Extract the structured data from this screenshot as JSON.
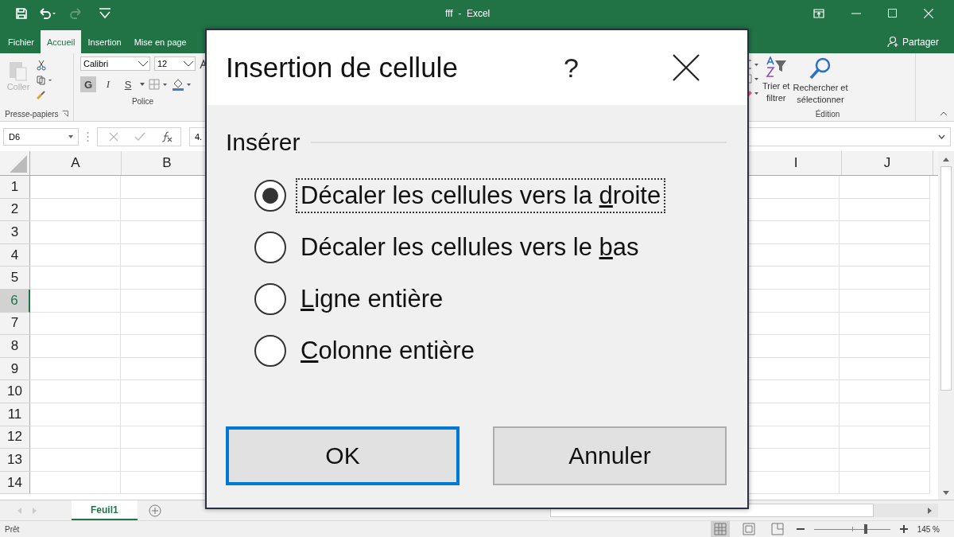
{
  "window": {
    "title": "fff  -  Excel"
  },
  "ribbon_tabs": [
    {
      "label": "Fichier",
      "selected": false
    },
    {
      "label": "Accueil",
      "selected": true
    },
    {
      "label": "Insertion",
      "selected": false
    },
    {
      "label": "Mise en page",
      "selected": false
    }
  ],
  "share": {
    "label": "Partager"
  },
  "clipboard": {
    "paste_label": "Coller",
    "paste_disabled": true,
    "group_label": "Presse-papiers"
  },
  "font_group": {
    "font": "Calibri",
    "size": "12",
    "bold_label": "G",
    "bold_on": true,
    "italic_label": "I",
    "underline_label": "S",
    "group_label": "Police"
  },
  "editing_group": {
    "sort_label": "Trier et\nfiltrer",
    "find_label": "Rechercher et\nsélectionner",
    "group_label": "Édition"
  },
  "formula_bar": {
    "name_box": "D6",
    "value": "4."
  },
  "columns": [
    {
      "label": "A",
      "selected": false
    },
    {
      "label": "B",
      "selected": false
    },
    {
      "label": "I",
      "selected": false
    },
    {
      "label": "J",
      "selected": false
    }
  ],
  "rows": [
    {
      "label": "1",
      "selected": false
    },
    {
      "label": "2",
      "selected": false
    },
    {
      "label": "3",
      "selected": false
    },
    {
      "label": "4",
      "selected": false
    },
    {
      "label": "5",
      "selected": false
    },
    {
      "label": "6",
      "selected": true
    },
    {
      "label": "7",
      "selected": false
    },
    {
      "label": "8",
      "selected": false
    },
    {
      "label": "9",
      "selected": false
    },
    {
      "label": "10",
      "selected": false
    },
    {
      "label": "11",
      "selected": false
    },
    {
      "label": "12",
      "selected": false
    },
    {
      "label": "13",
      "selected": false
    },
    {
      "label": "14",
      "selected": false
    }
  ],
  "sheets": [
    {
      "label": "Feuil1",
      "selected": true
    }
  ],
  "status_bar": {
    "status": "Prêt",
    "views": [
      {
        "kind": "normal",
        "selected": true
      },
      {
        "kind": "layout",
        "selected": false
      },
      {
        "kind": "pagebreak",
        "selected": false
      }
    ],
    "zoom": {
      "level": 0.68,
      "reading": "145 %"
    }
  },
  "dialog": {
    "title": "Insertion de cellule",
    "help": "?",
    "group_label": "Insérer",
    "options": [
      {
        "before": "Décaler les cellules vers la ",
        "key": "d",
        "after": "roite",
        "selected": true
      },
      {
        "before": "Décaler les cellules vers le ",
        "key": "b",
        "after": "as",
        "selected": false
      },
      {
        "key": "L",
        "after": "igne entière",
        "selected": false
      },
      {
        "key": "C",
        "after": "olonne entière",
        "selected": false
      }
    ],
    "buttons": [
      {
        "label": "OK",
        "default": true
      },
      {
        "label": "Annuler",
        "default": false
      }
    ]
  }
}
